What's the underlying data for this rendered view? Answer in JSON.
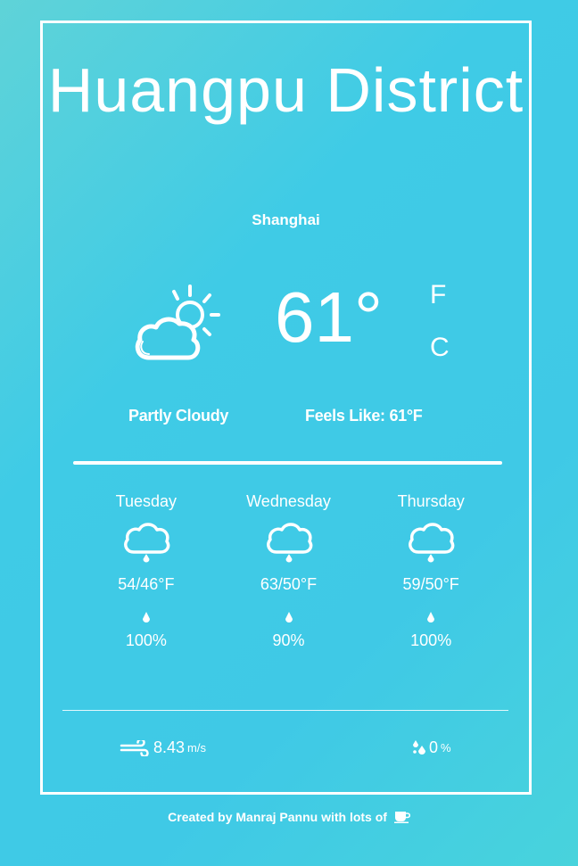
{
  "location": {
    "city": "Huangpu District",
    "region": "Shanghai"
  },
  "current": {
    "temperature": "61°",
    "unit_f": "F",
    "unit_c": "C",
    "condition": "Partly Cloudy",
    "feels_like": "Feels Like: 61°F",
    "icon": "partly-cloudy-icon"
  },
  "forecast": [
    {
      "day": "Tuesday",
      "range": "54/46°F",
      "rain": "100%",
      "icon": "rain-cloud-icon"
    },
    {
      "day": "Wednesday",
      "range": "63/50°F",
      "rain": "90%",
      "icon": "rain-cloud-icon"
    },
    {
      "day": "Thursday",
      "range": "59/50°F",
      "rain": "100%",
      "icon": "rain-cloud-icon"
    }
  ],
  "details": {
    "wind_value": "8.43",
    "wind_unit": "m/s",
    "humidity_value": "0",
    "humidity_unit": "%"
  },
  "footer": {
    "text": "Created by Manraj Pannu with lots of"
  },
  "colors": {
    "accent": "#ffffff",
    "background_start": "#5fd3d8",
    "background_mid": "#3fcbe6"
  }
}
